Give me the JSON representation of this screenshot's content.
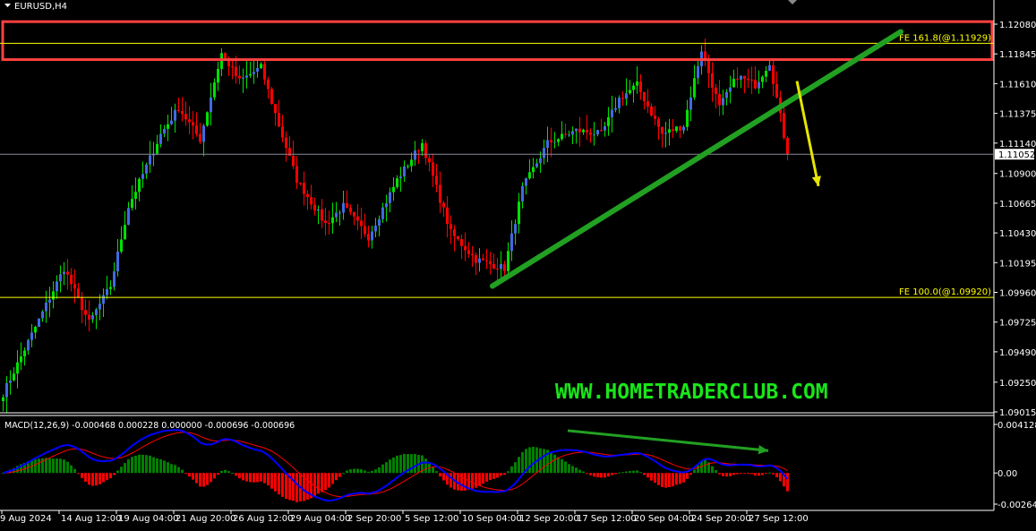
{
  "header": {
    "symbol_timeframe": "EURUSD,H4"
  },
  "watermark": "WWW.HOMETRADERCLUB.COM",
  "colors": {
    "bull": "#4169e1",
    "bull_alt": "#00e000",
    "bear": "#ff0000",
    "fe_line": "#ffff00",
    "zone": "#ff4040",
    "trend": "#22a022",
    "arrow": "#e6e600",
    "macd": "#0000ff",
    "signal": "#ff0000",
    "hist_up": "#008000",
    "hist_down": "#ff0000"
  },
  "chart_data": {
    "type": "candlestick",
    "symbol": "EURUSD",
    "timeframe": "H4",
    "ylim": [
      1.09015,
      1.1208
    ],
    "price_ticks": [
      "1.12080",
      "1.11845",
      "1.11610",
      "1.11375",
      "1.11140",
      "1.10900",
      "1.10665",
      "1.10430",
      "1.10195",
      "1.09960",
      "1.09725",
      "1.09490",
      "1.09250",
      "1.09015"
    ],
    "current_price": "1.11052",
    "time_labels": [
      "9 Aug 2024",
      "14 Aug 12:00",
      "19 Aug 04:00",
      "21 Aug 20:00",
      "26 Aug 12:00",
      "29 Aug 04:00",
      "2 Sep 20:00",
      "5 Sep 12:00",
      "10 Sep 04:00",
      "12 Sep 20:00",
      "17 Sep 12:00",
      "20 Sep 04:00",
      "24 Sep 20:00",
      "27 Sep 12:00"
    ],
    "bars_per_label": 16,
    "close_path": [
      [
        0,
        1.0916
      ],
      [
        12,
        1.0986
      ],
      [
        17,
        1.1015
      ],
      [
        24,
        1.0972
      ],
      [
        30,
        1.1001
      ],
      [
        35,
        1.1064
      ],
      [
        44,
        1.1121
      ],
      [
        49,
        1.1142
      ],
      [
        55,
        1.1117
      ],
      [
        61,
        1.1185
      ],
      [
        66,
        1.1163
      ],
      [
        72,
        1.1174
      ],
      [
        77,
        1.1128
      ],
      [
        82,
        1.1085
      ],
      [
        90,
        1.105
      ],
      [
        95,
        1.1064
      ],
      [
        102,
        1.104
      ],
      [
        110,
        1.1085
      ],
      [
        117,
        1.1114
      ],
      [
        125,
        1.1043
      ],
      [
        132,
        1.1022
      ],
      [
        140,
        1.1015
      ],
      [
        145,
        1.1078
      ],
      [
        152,
        1.1114
      ],
      [
        160,
        1.1124
      ],
      [
        167,
        1.1121
      ],
      [
        172,
        1.1149
      ],
      [
        177,
        1.116
      ],
      [
        184,
        1.1121
      ],
      [
        190,
        1.1128
      ],
      [
        195,
        1.1188
      ],
      [
        200,
        1.1142
      ],
      [
        205,
        1.1167
      ],
      [
        210,
        1.116
      ],
      [
        214,
        1.1178
      ],
      [
        217,
        1.1135
      ],
      [
        219,
        1.1105
      ]
    ],
    "fibo_levels": [
      {
        "label": "FE 161.8(@1.11929)",
        "price": 1.11929
      },
      {
        "label": "FE 100.0(@1.09920)",
        "price": 1.0992
      }
    ],
    "resistance_zone": [
      1.118,
      1.121
    ],
    "trendline": {
      "from": [
        137,
        1.1001
      ],
      "to": [
        251,
        1.1202
      ]
    },
    "forecast_arrow": {
      "from": [
        222,
        1.1163
      ],
      "to": [
        228,
        1.108
      ]
    },
    "macd": {
      "label": "MACD(12,26,9) -0.000468 0.000228 0.000000 -0.000696 -0.000696",
      "ylim": [
        -0.002649,
        0.004128
      ],
      "ticks": [
        "0.004128",
        "0.00",
        "-0.002649"
      ],
      "divergence_arrow": {
        "from": [
          158,
          0.0036
        ],
        "to": [
          214,
          0.0019
        ]
      }
    }
  }
}
